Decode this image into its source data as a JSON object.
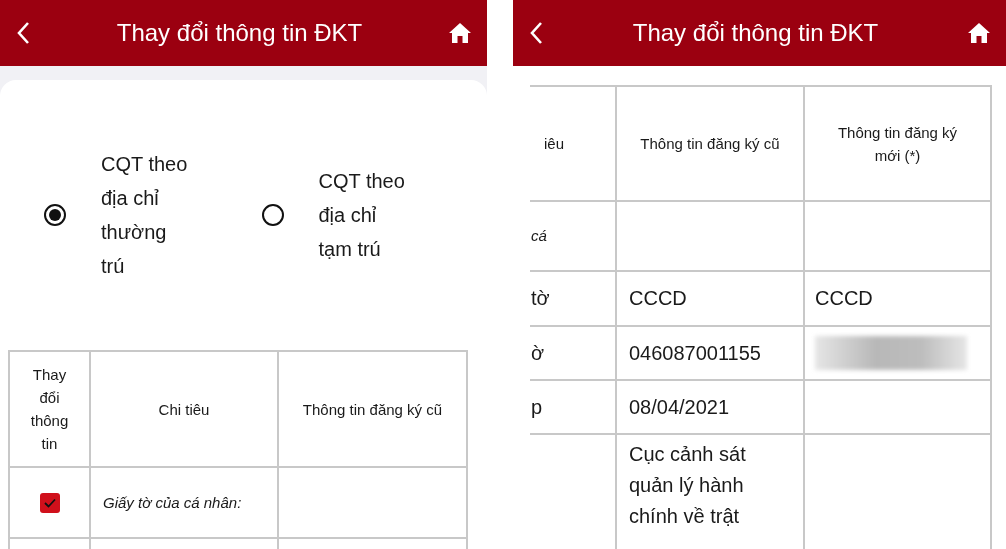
{
  "left_screen": {
    "header": {
      "title": "Thay đổi thông tin ĐKT"
    },
    "radios": [
      {
        "label": "CQT theo địa chỉ thường trú",
        "selected": true
      },
      {
        "label": "CQT theo địa chỉ tạm trú",
        "selected": false
      }
    ],
    "table": {
      "columns": [
        "Thay đổi thông tin",
        "Chi tiêu",
        "Thông tin đăng ký cũ"
      ],
      "rows": [
        {
          "kind": "group",
          "checked": true,
          "label": "Giấy tờ của cá nhân:"
        }
      ]
    }
  },
  "right_screen": {
    "header": {
      "title": "Thay đổi thông tin ĐKT"
    },
    "table": {
      "columns": [
        "iêu",
        "Thông tin đăng ký cũ",
        "Thông tin đăng ký mới (*)"
      ],
      "rows": [
        {
          "kind": "group",
          "label": "cá",
          "redacted": false
        },
        {
          "kind": "field",
          "label": "tờ",
          "old": "CCCD",
          "new": "CCCD",
          "redacted": false
        },
        {
          "kind": "field",
          "label": "ờ",
          "old": "046087001155",
          "redacted": true
        },
        {
          "kind": "field",
          "label": "p",
          "old": "08/04/2021",
          "redacted": false
        },
        {
          "kind": "field",
          "old": "Cục cảnh sát quản lý hành chính về trật",
          "redacted": false
        }
      ]
    }
  }
}
